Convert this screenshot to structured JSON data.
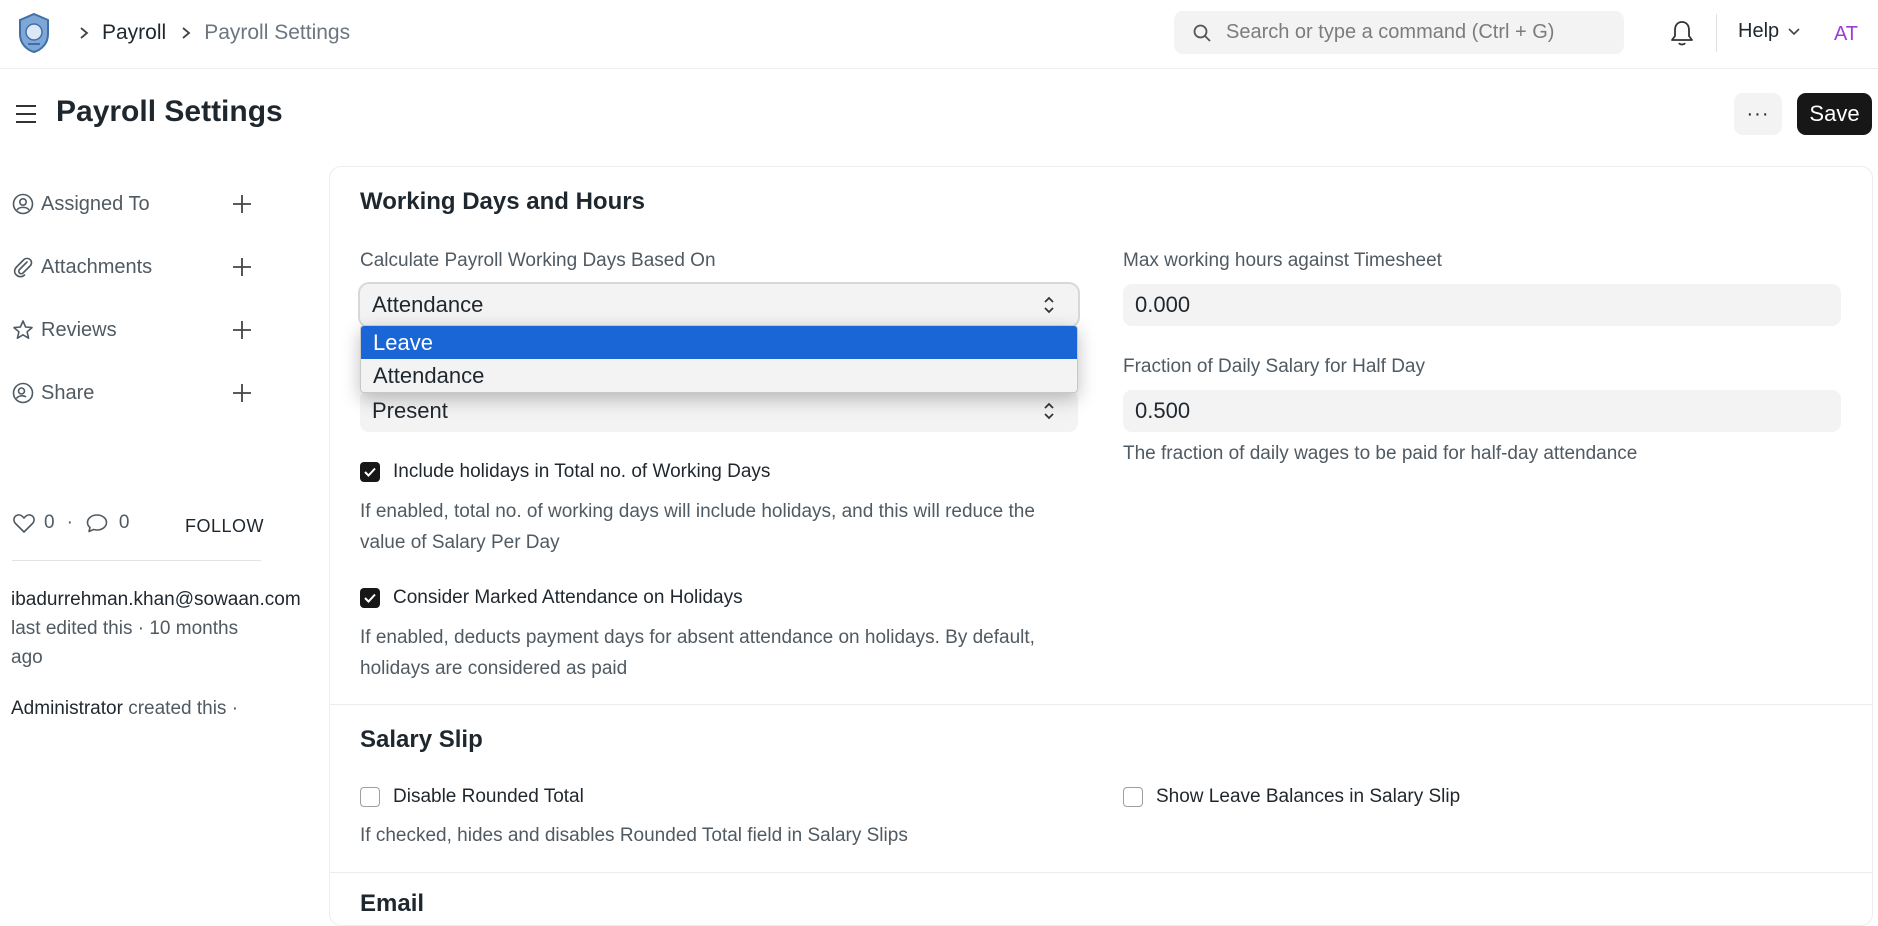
{
  "navbar": {
    "breadcrumbs": [
      "Payroll",
      "Payroll Settings"
    ],
    "search_placeholder": "Search or type a command (Ctrl + G)",
    "help_label": "Help",
    "avatar_initials": "AT"
  },
  "page": {
    "title": "Payroll Settings",
    "more_label": "···",
    "save_label": "Save"
  },
  "sidebar": {
    "items": [
      {
        "label": "Assigned To",
        "icon": "user-circle-icon"
      },
      {
        "label": "Attachments",
        "icon": "paperclip-icon"
      },
      {
        "label": "Reviews",
        "icon": "star-icon"
      },
      {
        "label": "Share",
        "icon": "user-share-icon"
      }
    ],
    "likes": "0",
    "comments": "0",
    "dot": "·",
    "follow_label": "FOLLOW",
    "activity": [
      {
        "who": "ibadurrehman.khan@sowaan.com",
        "text": "last edited this · 10 months ago"
      },
      {
        "who": "Administrator",
        "text": "created this ·"
      }
    ]
  },
  "form": {
    "section1": {
      "title": "Working Days and Hours",
      "calc_label": "Calculate Payroll Working Days Based On",
      "calc_value": "Attendance",
      "dropdown_options": [
        "Leave",
        "Attendance"
      ],
      "dropdown_highlighted": "Leave",
      "second_select_value": "Present",
      "include_holidays_label": "Include holidays in Total no. of Working Days",
      "include_holidays_checked": true,
      "include_holidays_help": "If enabled, total no. of working days will include holidays, and this will reduce the value of Salary Per Day",
      "marked_attendance_label": "Consider Marked Attendance on Holidays",
      "marked_attendance_checked": true,
      "marked_attendance_help": "If enabled, deducts payment days for absent attendance on holidays. By default, holidays are considered as paid",
      "max_hours_label": "Max working hours against Timesheet",
      "max_hours_value": "0.000",
      "half_day_label": "Fraction of Daily Salary for Half Day",
      "half_day_value": "0.500",
      "half_day_help": "The fraction of daily wages to be paid for half-day attendance"
    },
    "section2": {
      "title": "Salary Slip",
      "disable_rounded_label": "Disable Rounded Total",
      "disable_rounded_checked": false,
      "disable_rounded_help": "If checked, hides and disables Rounded Total field in Salary Slips",
      "show_leave_label": "Show Leave Balances in Salary Slip",
      "show_leave_checked": false
    },
    "section3": {
      "title": "Email"
    }
  },
  "colors": {
    "primary_button": "#171717",
    "dropdown_highlight": "#1a66d6",
    "avatar_text": "#9b3dd6"
  }
}
